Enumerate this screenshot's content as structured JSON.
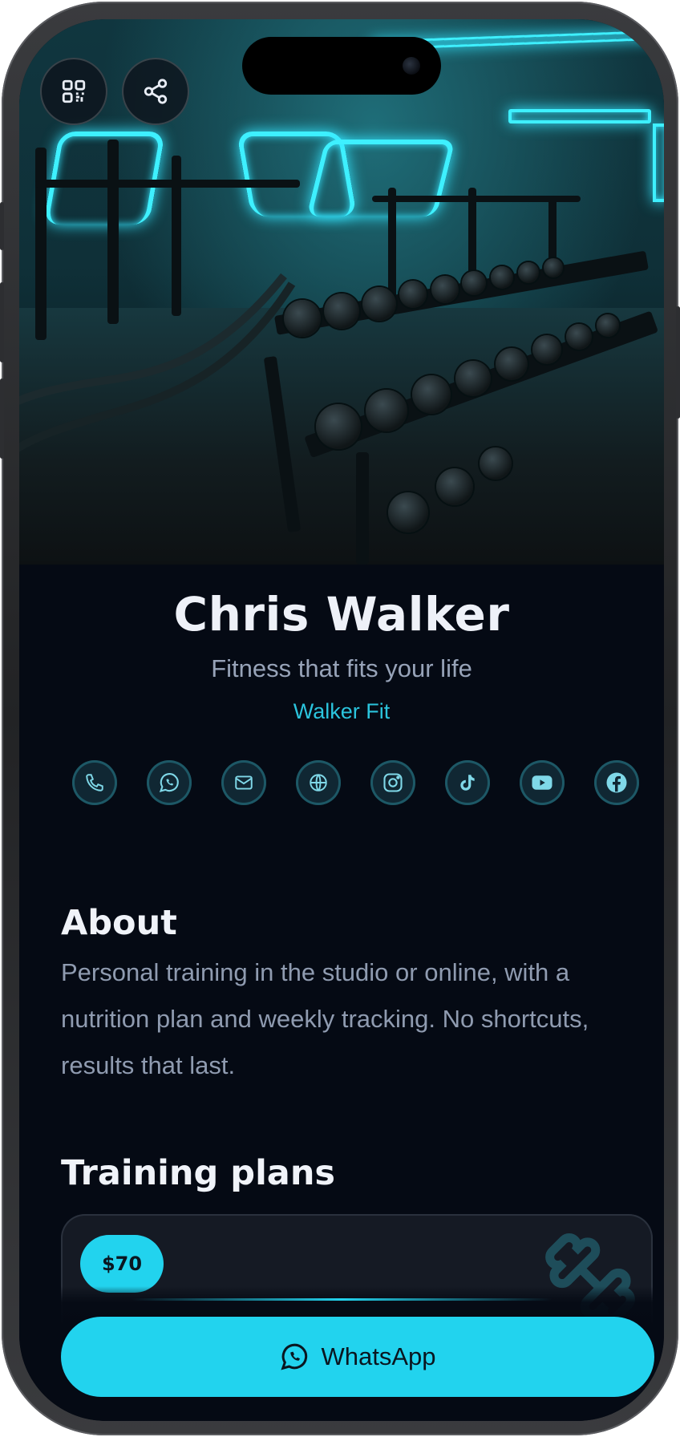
{
  "header": {
    "qr_button_icon": "qr-code-icon",
    "share_button_icon": "share-icon"
  },
  "profile": {
    "name": "Chris Walker",
    "tagline": "Fitness that fits your life",
    "brand": "Walker Fit"
  },
  "socials": [
    {
      "icon": "phone-icon"
    },
    {
      "icon": "whatsapp-icon"
    },
    {
      "icon": "mail-icon"
    },
    {
      "icon": "globe-icon"
    },
    {
      "icon": "instagram-icon"
    },
    {
      "icon": "tiktok-icon"
    },
    {
      "icon": "youtube-icon"
    },
    {
      "icon": "facebook-icon"
    }
  ],
  "about": {
    "heading": "About",
    "text": "Personal training in the studio or online, with a nutrition plan and weekly tracking. No shortcuts, results that last."
  },
  "plans": {
    "heading": "Training plans",
    "items": [
      {
        "price": "$70",
        "icon": "dumbbell-icon"
      }
    ]
  },
  "cta": {
    "label": "WhatsApp",
    "icon": "whatsapp-icon"
  },
  "colors": {
    "accent": "#22d3ee",
    "background": "#050a14",
    "card": "#151a24"
  }
}
